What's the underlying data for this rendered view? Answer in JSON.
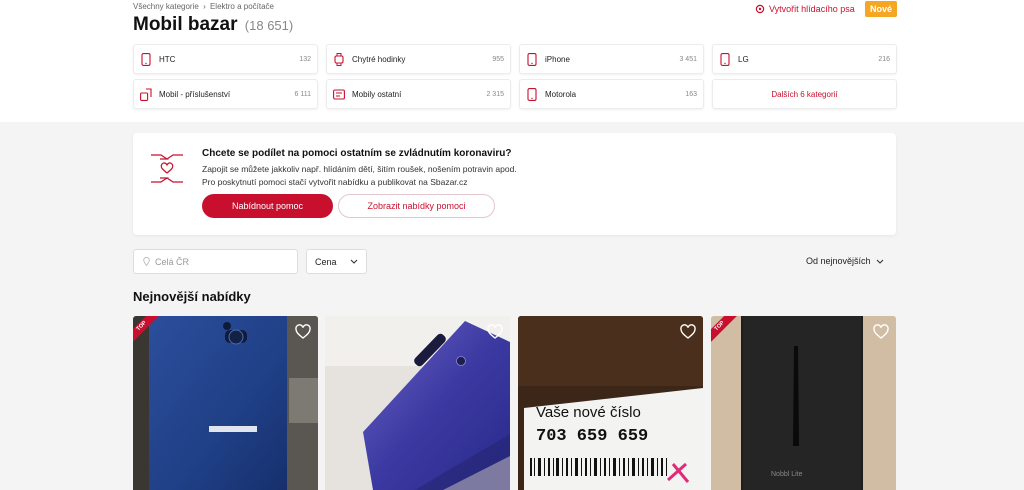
{
  "breadcrumb": [
    "Všechny kategorie",
    "›",
    "Elektro a počítače"
  ],
  "header": {
    "title": "Mobil bazar",
    "count": "(18 651)",
    "watchdog_label": "Vytvořit hlídacího psa",
    "new_badge": "Nové"
  },
  "categories": [
    {
      "label": "HTC",
      "count": "132",
      "icon": "phone-icon"
    },
    {
      "label": "Chytré hodinky",
      "count": "955",
      "icon": "watch-icon"
    },
    {
      "label": "iPhone",
      "count": "3 451",
      "icon": "phone-icon"
    },
    {
      "label": "LG",
      "count": "216",
      "icon": "phone-icon"
    },
    {
      "label": "Mobil - příslušenství",
      "count": "6 111",
      "icon": "accessory-icon"
    },
    {
      "label": "Mobily ostatní",
      "count": "2 315",
      "icon": "phone-other-icon"
    },
    {
      "label": "Motorola",
      "count": "163",
      "icon": "phone-icon"
    }
  ],
  "more_categories": "Dalších 6 kategorií",
  "help": {
    "title": "Chcete se podílet na pomoci ostatním se zvládnutím koronaviru?",
    "line1": "Zapojit se můžete jakkoliv např. hlídáním dětí, šitím roušek, nošením potravin apod.",
    "line2": "Pro poskytnutí pomoci stačí vytvořit nabídku a publikovat na Sbazar.cz",
    "offer_button": "Nabídnout pomoc",
    "show_button": "Zobrazit nabídky pomoci"
  },
  "filters": {
    "location_placeholder": "Celá ČR",
    "price_label": "Cena",
    "sort_label": "Od nejnovějších"
  },
  "listings_title": "Nejnovější nabídky",
  "listings": [
    {
      "top": true,
      "top_label": "TOP"
    },
    {
      "top": false
    },
    {
      "top": false,
      "photo_text": [
        "Vaše nové číslo",
        "703 659 659"
      ]
    },
    {
      "top": true,
      "top_label": "TOP",
      "photo_text": [
        "Nobbl Lite"
      ]
    }
  ],
  "colors": {
    "accent": "#c8102e",
    "badge": "#f5a623"
  }
}
